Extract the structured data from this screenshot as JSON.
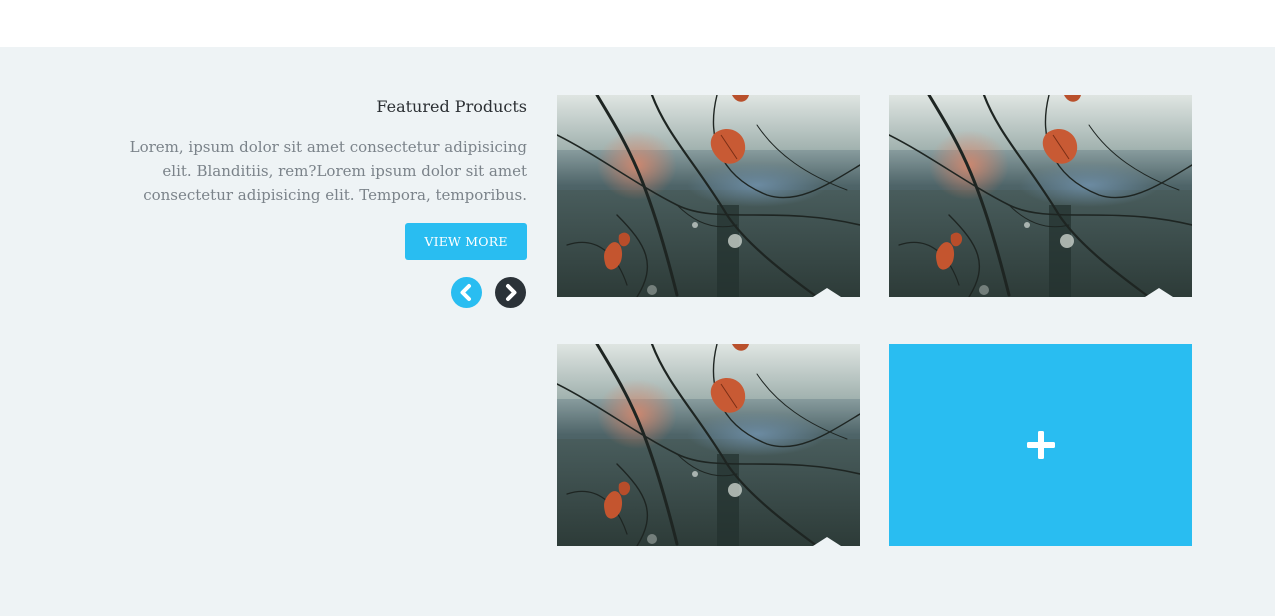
{
  "featured": {
    "title": "Featured Products",
    "description": "Lorem, ipsum dolor sit amet consectetur adipisicing elit. Blanditiis, rem?Lorem ipsum dolor sit amet consectetur adipisicing elit. Tempora, temporibus.",
    "view_more_label": "VIEW MORE"
  },
  "carousel": {
    "prev_icon": "chevron-left-icon",
    "next_icon": "chevron-right-icon"
  },
  "products": [
    {
      "image": "autumn-leaves-branch-photo"
    },
    {
      "image": "autumn-leaves-branch-photo"
    },
    {
      "image": "autumn-leaves-branch-photo"
    }
  ],
  "add_card": {
    "icon": "plus-icon"
  },
  "colors": {
    "accent": "#29bdf1",
    "dark": "#2b3238",
    "section_bg": "#eef3f5",
    "heading": "#2b2f33",
    "body_text": "#7b838a"
  }
}
